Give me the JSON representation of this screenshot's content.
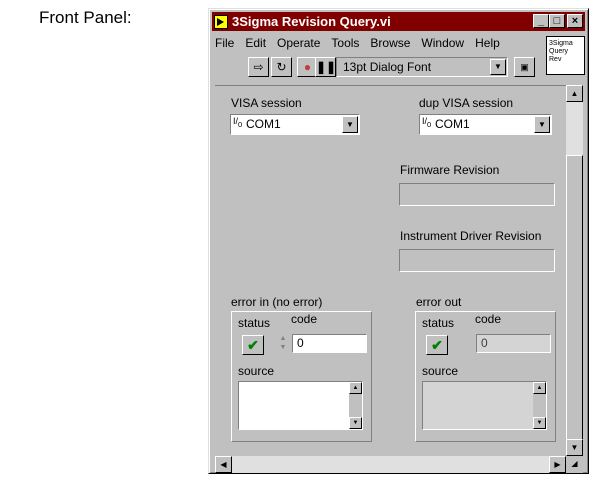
{
  "caption": "Front Panel:",
  "window": {
    "title": "3Sigma Revision Query.vi",
    "buttons": {
      "minimize": "_",
      "maximize": "□",
      "close": "×"
    }
  },
  "menu": [
    "File",
    "Edit",
    "Operate",
    "Tools",
    "Browse",
    "Window",
    "Help"
  ],
  "toolbar": {
    "font_select": "13pt Dialog Font",
    "icons": [
      "run-arrow-icon",
      "run-continuous-icon",
      "abort-stop-icon",
      "pause-icon"
    ]
  },
  "vi_icon": {
    "lines": [
      "3Sigma",
      "Query",
      "Rev"
    ]
  },
  "controls": {
    "visa_session": {
      "label": "VISA session",
      "value": "COM1",
      "io_glyph": "I/0"
    },
    "dup_visa_session": {
      "label": "dup VISA session",
      "value": "COM1",
      "io_glyph": "I/0"
    },
    "firmware_revision": {
      "label": "Firmware Revision",
      "value": ""
    },
    "driver_revision": {
      "label": "Instrument Driver Revision",
      "value": ""
    },
    "error_in": {
      "label": "error in (no error)",
      "status_label": "status",
      "code_label": "code",
      "code_value": "0",
      "source_label": "source",
      "status_glyph": "✔"
    },
    "error_out": {
      "label": "error out",
      "status_label": "status",
      "code_label": "code",
      "code_value": "0",
      "source_label": "source",
      "status_glyph": "✔"
    }
  },
  "colors": {
    "title_bar": "#800000",
    "panel": "#c0c0c0",
    "check": "#008000"
  }
}
